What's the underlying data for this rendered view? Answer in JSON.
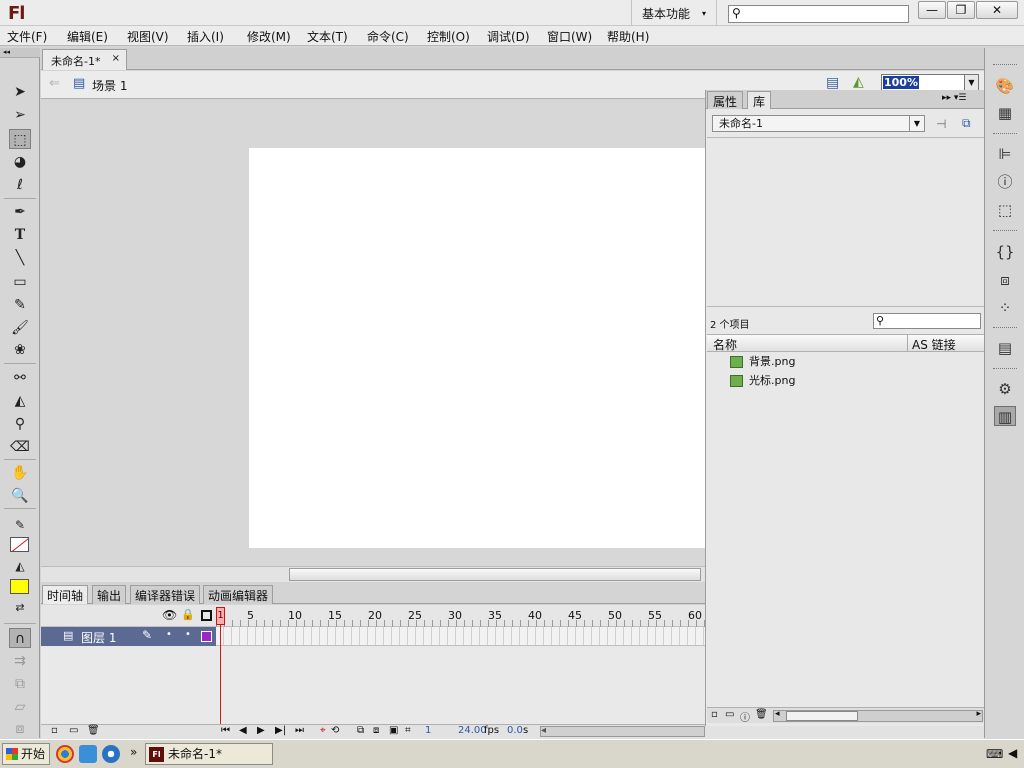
{
  "app": {
    "logo": "Fl",
    "workspace": "基本功能",
    "workspace_caret": "▾",
    "search_icon": "⚲",
    "window_buttons": [
      "—",
      "❐",
      "✕"
    ]
  },
  "menu": [
    "文件(F)",
    "编辑(E)",
    "视图(V)",
    "插入(I)",
    "修改(M)",
    "文本(T)",
    "命令(C)",
    "控制(O)",
    "调试(D)",
    "窗口(W)",
    "帮助(H)"
  ],
  "document": {
    "tab": "未命名-1*",
    "close": "×",
    "scene": "场景 1",
    "zoom": "100%",
    "zoom_caret": "▼"
  },
  "timeline": {
    "tabs": [
      "时间轴",
      "输出",
      "编译器错误",
      "动画编辑器"
    ],
    "frame_numbers": [
      "1",
      "5",
      "10",
      "15",
      "20",
      "25",
      "30",
      "35",
      "40",
      "45",
      "50",
      "55",
      "60"
    ],
    "layer": "图层 1",
    "current_frame": "1",
    "fps": "24.00",
    "fps_unit": "fps",
    "time": "0.0",
    "time_unit": "s"
  },
  "library": {
    "tabs": [
      "属性",
      "库"
    ],
    "tab_controls": "▸▸ ▾☰",
    "document": "未命名-1",
    "count": "2 个项目",
    "search_icon": "⚲",
    "col_name": "名称",
    "col_linkage": "AS 链接",
    "items": [
      "背景.png",
      "光标.png"
    ],
    "scroll_left": "◂",
    "scroll_right": "▸"
  },
  "taskbar": {
    "start": "开始",
    "window": "未命名-1*",
    "more": "»"
  },
  "tool_icons": [
    "selection-icon",
    "subselection-icon",
    "free-transform-icon",
    "3d-rotation-icon",
    "lasso-icon",
    "pen-icon",
    "text-icon",
    "line-icon",
    "rectangle-icon",
    "pencil-icon",
    "brush-icon",
    "deco-icon",
    "bone-icon",
    "paint-bucket-icon",
    "eyedropper-icon",
    "eraser-icon",
    "hand-icon",
    "zoom-icon"
  ],
  "colors": {
    "stroke": "#000000",
    "fill": "#ffff00",
    "layer_highlight": "#5a6a93",
    "layer_color": "#9b27c5",
    "playhead": "#d31c1c"
  }
}
